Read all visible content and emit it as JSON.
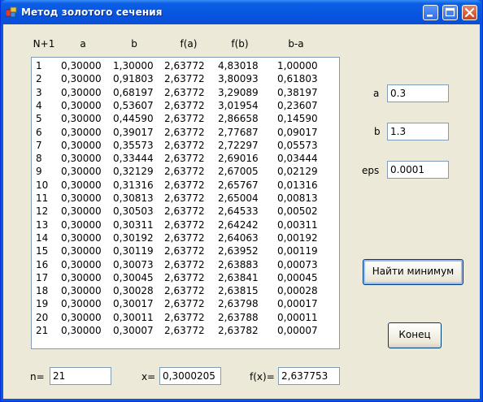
{
  "window": {
    "title": "Метод золотого сечения",
    "controls": {
      "minimize": "minimize-icon",
      "maximize": "maximize-icon",
      "close": "close-icon"
    }
  },
  "table": {
    "headers": [
      "N+1",
      "a",
      "b",
      "f(a)",
      "f(b)",
      "b-a"
    ],
    "rows": [
      [
        "1",
        "0,30000",
        "1,30000",
        "2,63772",
        "4,83018",
        "1,00000"
      ],
      [
        "2",
        "0,30000",
        "0,91803",
        "2,63772",
        "3,80093",
        "0,61803"
      ],
      [
        "3",
        "0,30000",
        "0,68197",
        "2,63772",
        "3,29089",
        "0,38197"
      ],
      [
        "4",
        "0,30000",
        "0,53607",
        "2,63772",
        "3,01954",
        "0,23607"
      ],
      [
        "5",
        "0,30000",
        "0,44590",
        "2,63772",
        "2,86658",
        "0,14590"
      ],
      [
        "6",
        "0,30000",
        "0,39017",
        "2,63772",
        "2,77687",
        "0,09017"
      ],
      [
        "7",
        "0,30000",
        "0,35573",
        "2,63772",
        "2,72297",
        "0,05573"
      ],
      [
        "8",
        "0,30000",
        "0,33444",
        "2,63772",
        "2,69016",
        "0,03444"
      ],
      [
        "9",
        "0,30000",
        "0,32129",
        "2,63772",
        "2,67005",
        "0,02129"
      ],
      [
        "10",
        "0,30000",
        "0,31316",
        "2,63772",
        "2,65767",
        "0,01316"
      ],
      [
        "11",
        "0,30000",
        "0,30813",
        "2,63772",
        "2,65004",
        "0,00813"
      ],
      [
        "12",
        "0,30000",
        "0,30503",
        "2,63772",
        "2,64533",
        "0,00502"
      ],
      [
        "13",
        "0,30000",
        "0,30311",
        "2,63772",
        "2,64242",
        "0,00311"
      ],
      [
        "14",
        "0,30000",
        "0,30192",
        "2,63772",
        "2,64063",
        "0,00192"
      ],
      [
        "15",
        "0,30000",
        "0,30119",
        "2,63772",
        "2,63952",
        "0,00119"
      ],
      [
        "16",
        "0,30000",
        "0,30073",
        "2,63772",
        "2,63883",
        "0,00073"
      ],
      [
        "17",
        "0,30000",
        "0,30045",
        "2,63772",
        "2,63841",
        "0,00045"
      ],
      [
        "18",
        "0,30000",
        "0,30028",
        "2,63772",
        "2,63815",
        "0,00028"
      ],
      [
        "19",
        "0,30000",
        "0,30017",
        "2,63772",
        "2,63798",
        "0,00017"
      ],
      [
        "20",
        "0,30000",
        "0,30011",
        "2,63772",
        "2,63788",
        "0,00011"
      ],
      [
        "21",
        "0,30000",
        "0,30007",
        "2,63772",
        "2,63782",
        "0,00007"
      ]
    ]
  },
  "inputs": {
    "a": {
      "label": "a",
      "value": "0.3"
    },
    "b": {
      "label": "b",
      "value": "1.3"
    },
    "eps": {
      "label": "eps",
      "value": "0.0001"
    }
  },
  "buttons": {
    "find_min": "Найти минимум",
    "end": "Конец"
  },
  "results": {
    "n": {
      "label": "n=",
      "value": "21"
    },
    "x": {
      "label": "x=",
      "value": "0,3000205"
    },
    "fx": {
      "label": "f(x)=",
      "value": "2,637753"
    }
  }
}
